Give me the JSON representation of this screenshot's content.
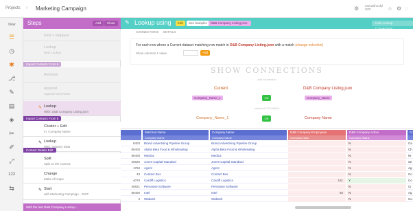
{
  "topbar": {
    "projects": "Projects",
    "separator": "›",
    "title": "Marketing Campaign",
    "gear_icon": "gear-icon",
    "user_line1": "userwithnofyl",
    "user_line2": "OFF",
    "help_icon": "help-icon",
    "settings_icon": "settings-icon",
    "info_icon": "info-icon"
  },
  "rail": {
    "top_label": "View",
    "counter_label": "123"
  },
  "steps": {
    "title": "Steps",
    "buttons": [
      "Add",
      "Close"
    ],
    "items": [
      {
        "name": "Find + Replace",
        "desc": "",
        "dim": true
      },
      {
        "name": "Lookup",
        "desc": "New Lookup",
        "dim": true
      },
      {
        "name": "Remove",
        "desc": "",
        "dim": true
      },
      {
        "name": "Append",
        "desc": "Append New Rows",
        "dim": true
      },
      {
        "name": "Lookup",
        "desc": "With: D&B Company Listing.json",
        "dim": false,
        "selected": true
      },
      {
        "name": "Cluster + Edit",
        "desc": "In: Company Name",
        "dim": false
      },
      {
        "name": "Lookup",
        "desc": "With: Industry Data",
        "dim": false
      },
      {
        "name": "Split",
        "desc": "Split on the comma",
        "dim": false
      },
      {
        "name": "Change",
        "desc": "Make All Caps",
        "dim": false
      },
      {
        "name": "Start",
        "desc": "with Marketing Campaign - GSIT",
        "dim": false
      }
    ],
    "group_tags": [
      "Import Contacts From 8",
      "Import Contacts From 8",
      "Contact Details Edit"
    ],
    "footer": "With the last D&B Company Lookup..."
  },
  "lookup": {
    "title": "Lookup using",
    "pill_edit": "Edit",
    "pill_samples": "See Samples",
    "pill_file": "D&B Company Listing.json",
    "pill_right": "Hide Lookup Connections",
    "tabs": [
      "CONNECTIONS",
      "DETAILS"
    ],
    "sentence_part1": "For each row where a Current dataset matching row match in",
    "sentence_bold": "D&B Company Listing.json",
    "sentence_part2": "with a match",
    "sentence_link": "(change selection)",
    "line2_label": "Show columns",
    "line2_value": "1 value",
    "add_label": "Add",
    "section_title": "SHOW CONNECTIONS",
    "section_sub": "add connection",
    "col_current": "Current",
    "col_lookup": "D&B Company Listing.json",
    "chip_left": "Company_Name_1",
    "chip_right": "Company_Name",
    "match_btn": "OK",
    "section_sub2": "selected COLUMNS",
    "row_left": "Company_Name_1",
    "row_right": "Company Name"
  },
  "table": {
    "headers": [
      {
        "name": "Matched Name",
        "type": "Company Name"
      },
      {
        "name": "Company Name",
        "type": "Company Name"
      },
      {
        "name": "D&B Company Employees",
        "type": "Company Data"
      },
      {
        "name": "D&B Company Active",
        "type": "Company Status"
      },
      {
        "name": "Co",
        "type": ""
      }
    ],
    "rows": [
      [
        "8403",
        "Brand Advertising Pipeline Group",
        "Brand Advertising Pipeline Group",
        "",
        "N",
        "Ca"
      ],
      [
        "85400",
        "Alpha Beta Food & Wholesaling",
        "Alpha Beta Food & Wholesaling",
        "",
        "N",
        "Ch"
      ],
      [
        "85400",
        "Medica",
        "Medica",
        "",
        "N",
        "NI"
      ],
      [
        "20620",
        "Jones Capital Standard",
        "Jones Capital Standard",
        "",
        "N",
        "Se"
      ],
      [
        "1763",
        "Agent",
        "Agent",
        "",
        "N",
        "Ag"
      ],
      [
        "43",
        "Contact Bus",
        "Contact Bus",
        "",
        "N",
        "Co"
      ],
      [
        "4079",
        "Cardiff Logistics",
        "Cardiff Logistics",
        "191",
        "Y",
        "Co"
      ],
      [
        "30621",
        "Pervasive Software",
        "Pervasive Software",
        "",
        "N",
        "Cr"
      ],
      [
        "85400",
        "Intel",
        "Intel",
        "50",
        "N",
        "Ag"
      ],
      [
        "3",
        "Wabash",
        "Wabash",
        "",
        "N",
        "Co"
      ]
    ]
  }
}
